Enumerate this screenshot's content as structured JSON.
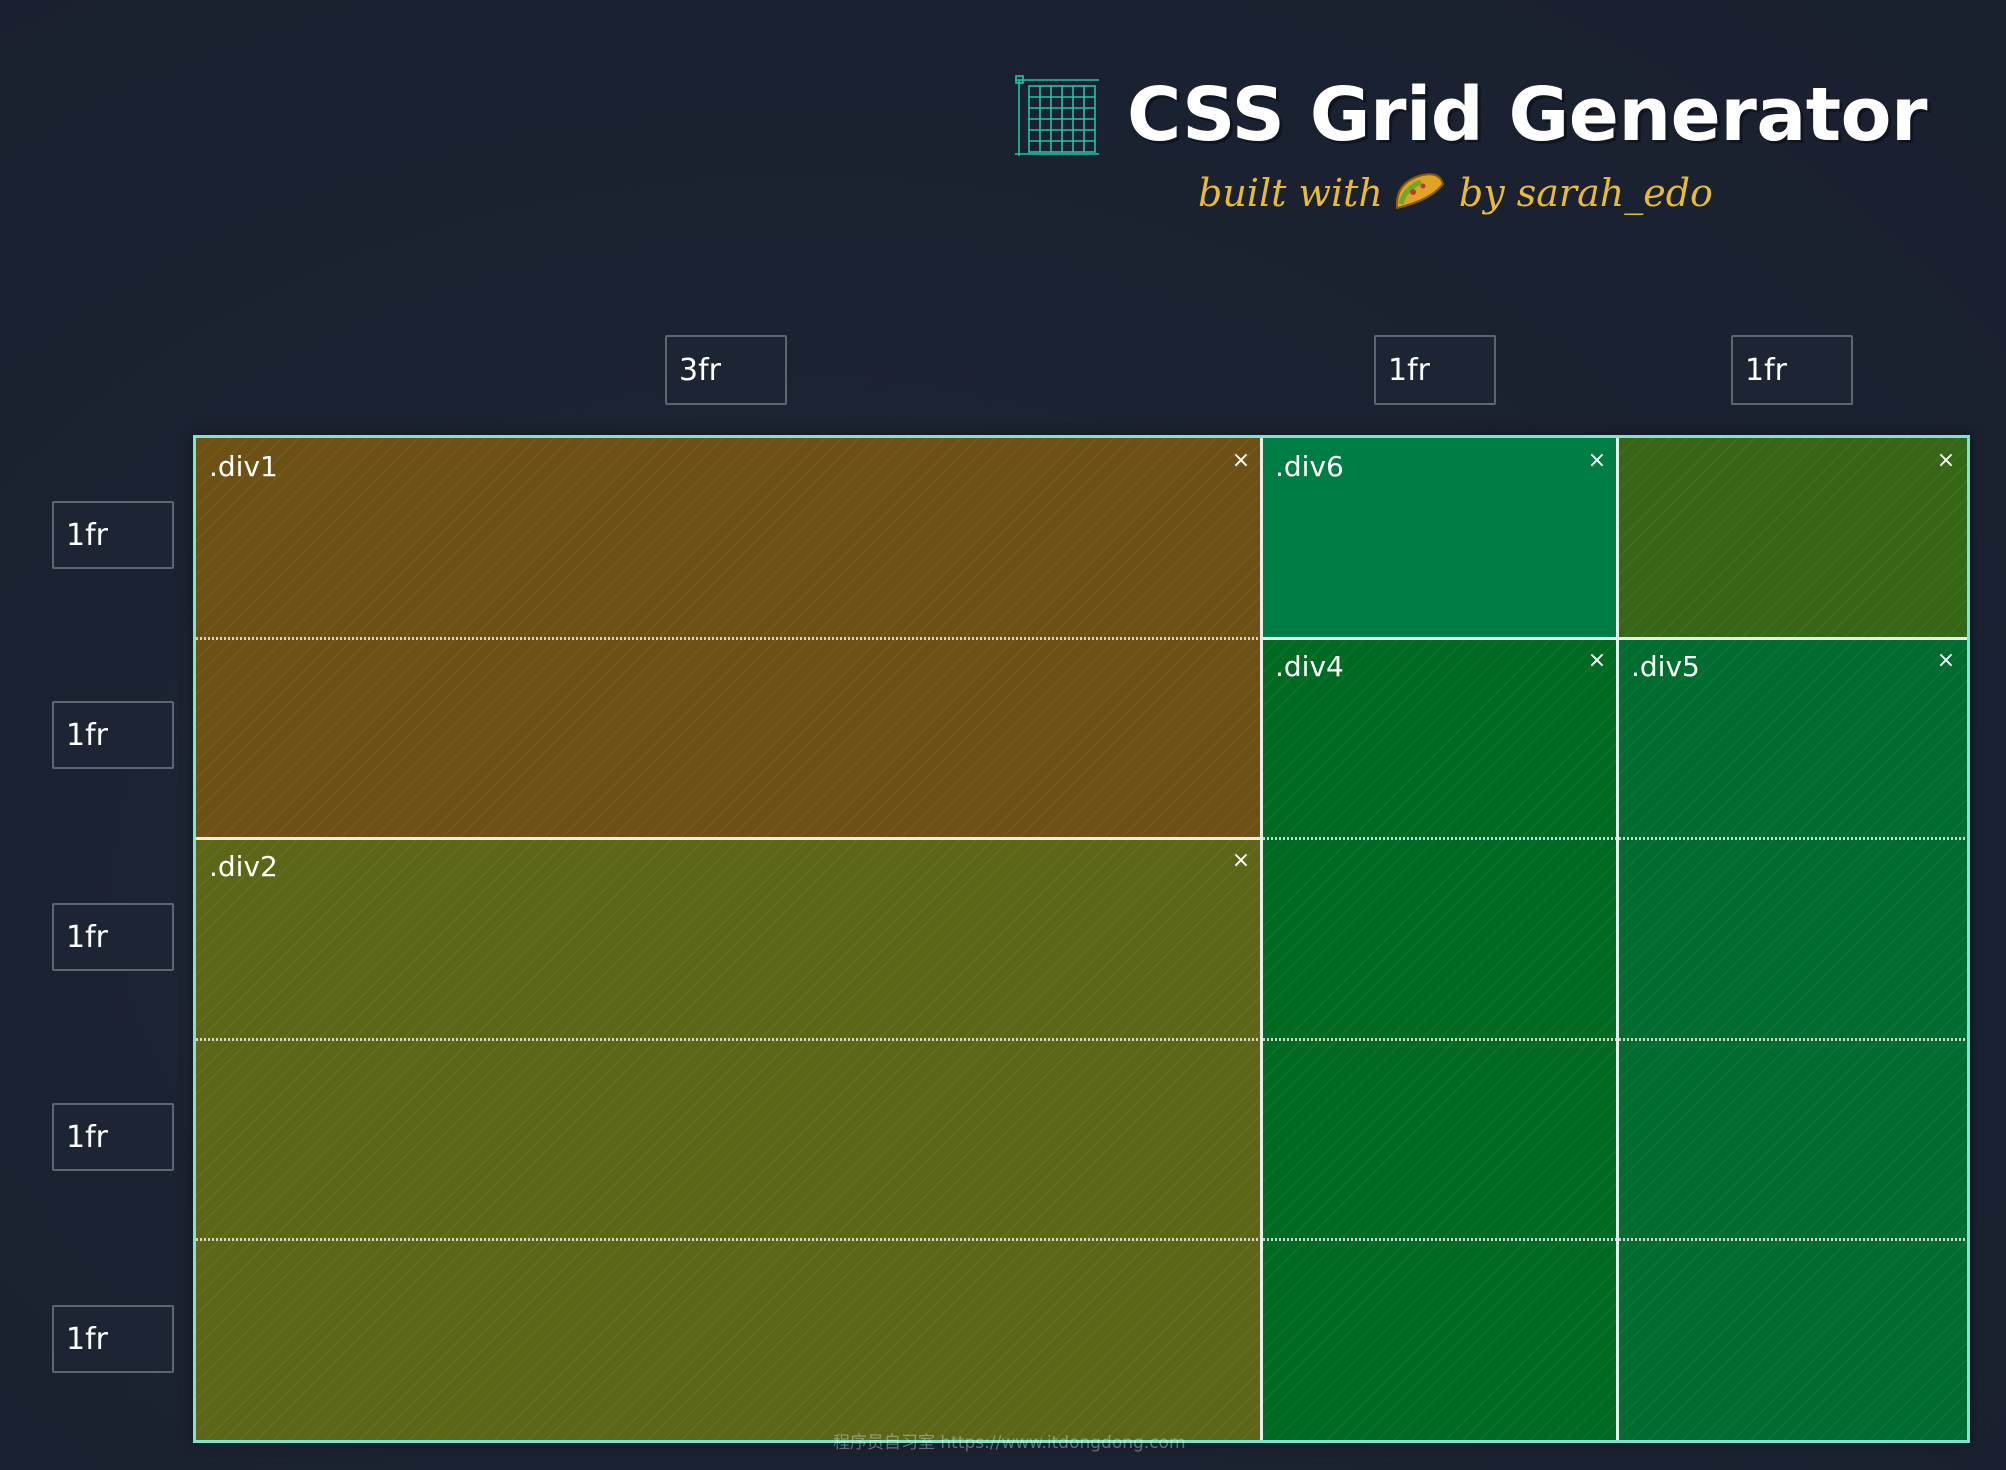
{
  "header": {
    "title": "CSS Grid Generator",
    "subtitle_prefix": "built with",
    "subtitle_suffix": "by sarah_edo",
    "logo_icon": "grid-icon",
    "taco_icon": "taco-icon"
  },
  "columns": [
    "3fr",
    "1fr",
    "1fr"
  ],
  "rows": [
    "1fr",
    "1fr",
    "1fr",
    "1fr",
    "1fr"
  ],
  "areas": [
    {
      "name": ".div1",
      "color": "#6d5013"
    },
    {
      "name": ".div2",
      "color": "#5d6517"
    },
    {
      "name": ".div6",
      "color": "#007c45"
    },
    {
      "name": "",
      "color": "#376616"
    },
    {
      "name": ".div4",
      "color": "#006a23"
    },
    {
      "name": ".div5",
      "color": "#006c2f"
    }
  ],
  "close_glyph": "×",
  "watermark": "程序员自习室 https://www.itdongdong.com",
  "colors": {
    "background": "#1b2231",
    "grid_border": "#7fe3cf",
    "subtitle": "#e8b93a",
    "input_border": "#5d6573"
  }
}
